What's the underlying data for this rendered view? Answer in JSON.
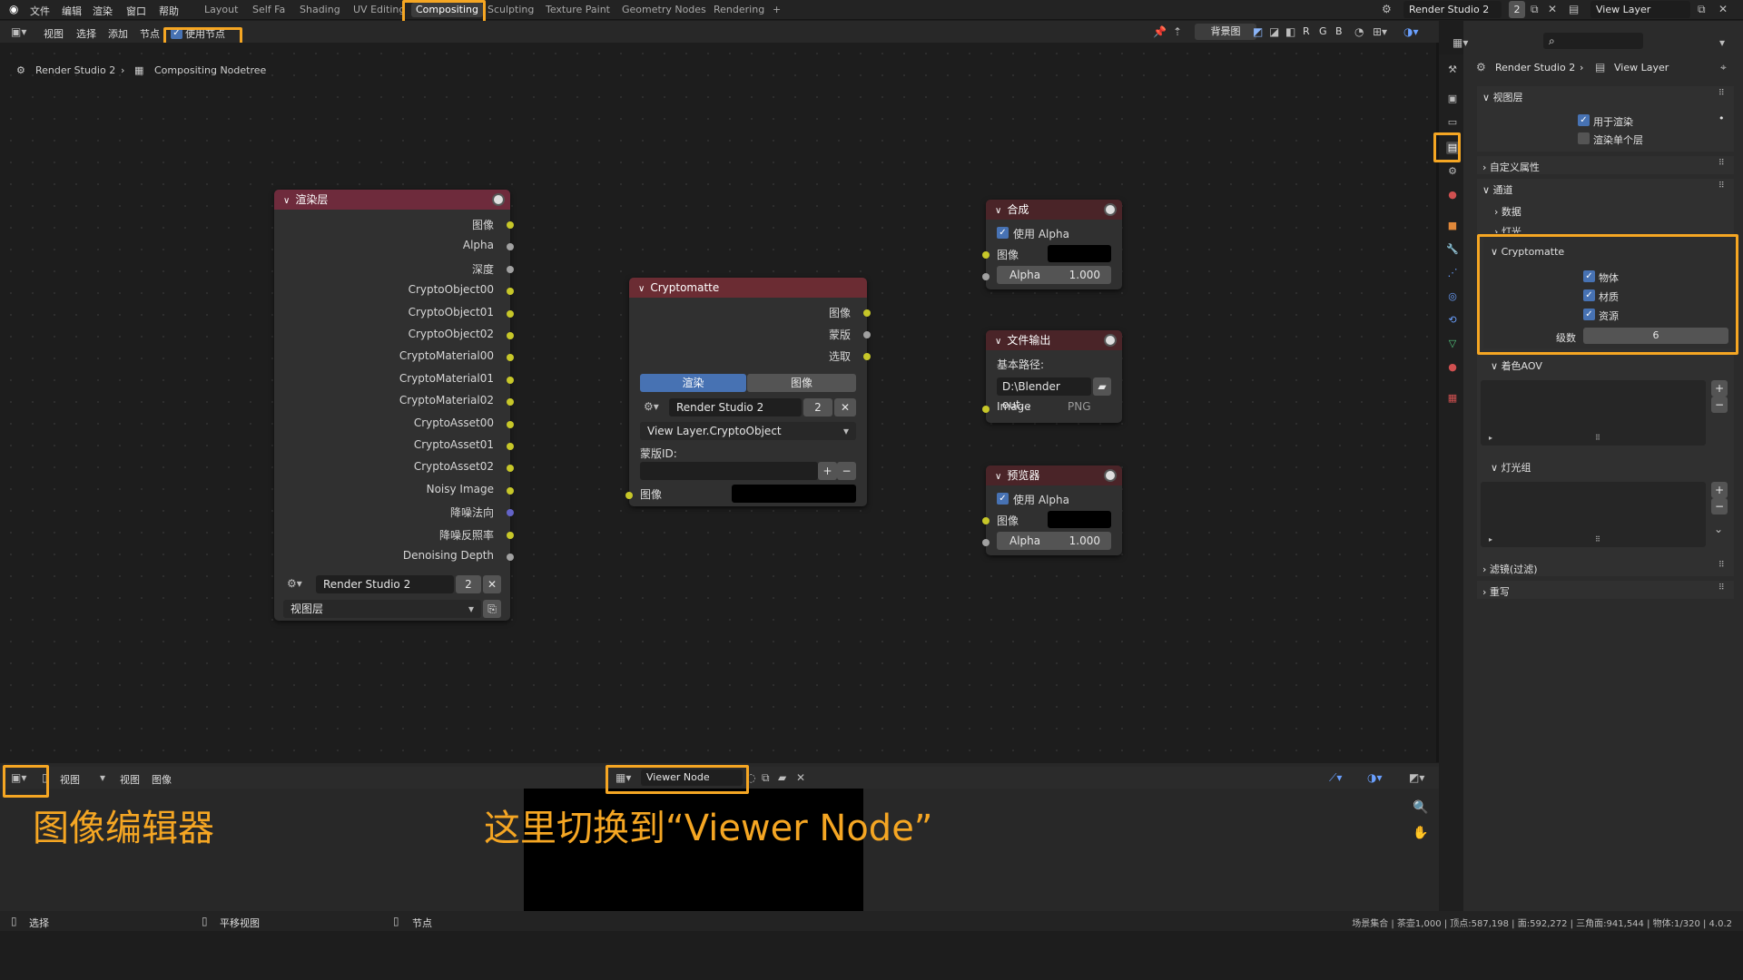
{
  "topbar": {
    "menus": [
      "文件",
      "编辑",
      "渲染",
      "窗口",
      "帮助"
    ],
    "workspaces": [
      "Layout",
      "Self Fa",
      "Shading",
      "UV Editing",
      "Compositing",
      "Sculpting",
      "Texture Paint",
      "Geometry Nodes",
      "Rendering",
      "+"
    ],
    "active_workspace": "Compositing",
    "scene_name": "Render Studio 2",
    "scene_users": "2",
    "view_layer": "View Layer"
  },
  "node_editor": {
    "header_menus": [
      "视图",
      "选择",
      "添加",
      "节点"
    ],
    "use_nodes_label": "使用节点",
    "backdrop_label": "背景图",
    "channels": [
      "R",
      "G",
      "B"
    ],
    "breadcrumb": [
      "Render Studio 2",
      "Compositing Nodetree"
    ]
  },
  "nodes": {
    "render_layers": {
      "title": "渲染层",
      "outputs": [
        "图像",
        "Alpha",
        "深度",
        "CryptoObject00",
        "CryptoObject01",
        "CryptoObject02",
        "CryptoMaterial00",
        "CryptoMaterial01",
        "CryptoMaterial02",
        "CryptoAsset00",
        "CryptoAsset01",
        "CryptoAsset02",
        "Noisy Image",
        "降噪法向",
        "降噪反照率",
        "Denoising Depth"
      ],
      "scene": "Render Studio 2",
      "scene_users": "2",
      "layer": "视图层"
    },
    "cryptomatte": {
      "title": "Cryptomatte",
      "outputs": [
        "图像",
        "蒙版",
        "选取"
      ],
      "tabs": [
        "渲染",
        "图像"
      ],
      "scene": "Render Studio 2",
      "scene_users": "2",
      "layer": "View Layer.CryptoObject",
      "matte_id_label": "蒙版ID:",
      "input_label": "图像"
    },
    "composite": {
      "title": "合成",
      "use_alpha": "使用 Alpha",
      "image_label": "图像",
      "alpha_label": "Alpha",
      "alpha_value": "1.000"
    },
    "file_output": {
      "title": "文件输出",
      "base_path_label": "基本路径:",
      "base_path": "D:\\Blender out...",
      "input_label": "Image",
      "format": "PNG"
    },
    "viewer": {
      "title": "预览器",
      "use_alpha": "使用 Alpha",
      "image_label": "图像",
      "alpha_label": "Alpha",
      "alpha_value": "1.000"
    }
  },
  "properties": {
    "breadcrumb": [
      "Render Studio 2",
      "View Layer"
    ],
    "view_layer_panel": "视图层",
    "use_for_render": "用于渲染",
    "render_single_layer": "渲染单个层",
    "custom_props": "自定义属性",
    "passes": "通道",
    "data": "数据",
    "light": "灯光",
    "cryptomatte": "Cryptomatte",
    "crypto_object": "物体",
    "crypto_material": "材质",
    "crypto_asset": "资源",
    "levels_label": "级数",
    "levels_value": "6",
    "shader_aov": "着色AOV",
    "light_groups": "灯光组",
    "filter": "滤镜(过滤)",
    "override": "重写"
  },
  "image_editor": {
    "view_label": "视图",
    "menus": [
      "视图",
      "图像"
    ],
    "image_name": "Viewer Node"
  },
  "annotations": {
    "image_editor": "图像编辑器",
    "switch_hint": "这里切换到“Viewer Node”"
  },
  "statusbar": {
    "select": "选择",
    "pan": "平移视图",
    "node": "节点",
    "stats": "场景集合 | 茶壶1,000 | 顶点:587,198 | 面:592,272 | 三角面:941,544 | 物体:1/320 | 4.0.2"
  },
  "colors": {
    "accent": "#f5a623",
    "render_header": "#6e2b3c",
    "output_header": "#4a2428",
    "crypto_header": "#6b2c33",
    "active_blue": "#4772b3"
  }
}
